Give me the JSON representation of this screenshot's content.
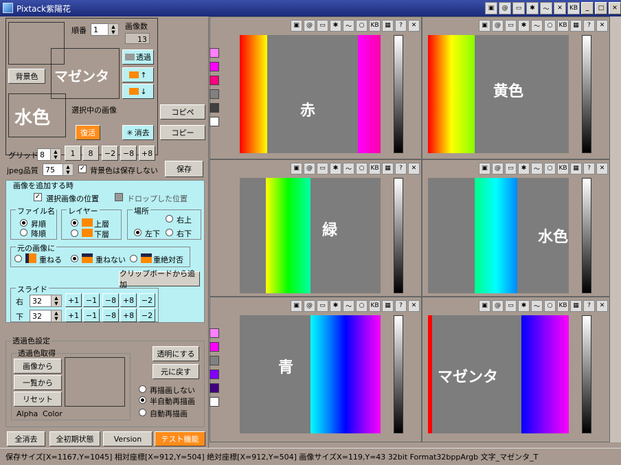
{
  "app": {
    "title": "Pixtack紫陽花"
  },
  "left": {
    "order_label": "順番",
    "order_value": "1",
    "image_count_label": "画像数",
    "image_count_value": "13",
    "bg_color_btn": "背景色",
    "fg_text": "マゼンタ",
    "bg_text": "水色",
    "transparent_btn": "透過",
    "up_btn": "↑",
    "down_btn": "↓",
    "selected_label": "選択中の画像",
    "restore_btn": "復活",
    "erase_btn": "消去",
    "copy_paste_btn": "コピペ",
    "copy_btn": "コピー",
    "grid_label": "グリッド",
    "grid_value": "8",
    "grid_buttons": [
      "1",
      "8",
      "−2",
      "−8",
      "+8"
    ],
    "jpeg_label": "jpeg品質",
    "jpeg_value": "75",
    "no_save_bg_label": "背景色は保存しない",
    "save_btn": "保存"
  },
  "add": {
    "title": "画像を追加する時",
    "sel_pos": "選択画像の位置",
    "drop_pos": "ドロップした位置",
    "filename_title": "ファイル名",
    "asc": "昇順",
    "desc": "降順",
    "layer_title": "レイヤー",
    "upper": "上層",
    "lower": "下層",
    "place_title": "場所",
    "top_right": "右上",
    "bottom_left": "左下",
    "bottom_right": "右下",
    "orig_title": "元の画像に",
    "overlap": "重ねる",
    "no_overlap": "重ねない",
    "never": "重絶対否",
    "clipboard_btn": "クリップボードから追加",
    "slide_title": "スライド",
    "right_label": "右",
    "down_label": "下",
    "right_value": "32",
    "down_value": "32",
    "slide_buttons": [
      "+1",
      "−1",
      "−8",
      "+8",
      "−2"
    ]
  },
  "trans": {
    "title": "透過色設定",
    "get_title": "透過色取得",
    "from_image": "画像から",
    "from_list": "一覧から",
    "reset": "リセット",
    "alpha": "Alpha",
    "color": "Color",
    "make_trans": "透明にする",
    "undo": "元に戻す",
    "no_redraw": "再描画しない",
    "semi_redraw": "半自動再描画",
    "auto_redraw": "自動再描画"
  },
  "bottom": {
    "clear_all": "全消去",
    "init_all": "全初期状態",
    "version": "Version",
    "test": "テスト機能"
  },
  "panels": [
    {
      "label": "赤"
    },
    {
      "label": "黄色"
    },
    {
      "label": "緑"
    },
    {
      "label": "水色"
    },
    {
      "label": "青"
    },
    {
      "label": "マゼンタ"
    }
  ],
  "status": "保存サイズ[X=1167,Y=1045]  相対座標[X=912,Y=504]  絶対座標[X=912,Y=504]  画像サイズX=119,Y=43  32bit  Format32bppArgb  文字_マゼンタ_T",
  "colors": {
    "cyan_panel": "#b8f0f4",
    "orange": "#ff8c1a"
  }
}
